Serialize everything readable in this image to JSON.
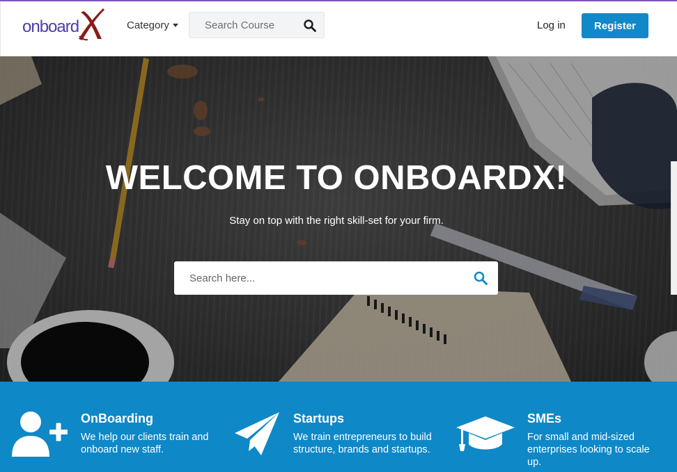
{
  "header": {
    "logo_text": "onboard",
    "category_label": "Category",
    "search_placeholder": "Search Course",
    "login_label": "Log in",
    "register_label": "Register"
  },
  "hero": {
    "title": "WELCOME TO ONBOARDX!",
    "subtitle": "Stay on top with the right skill-set for your firm.",
    "search_placeholder": "Search here..."
  },
  "features": [
    {
      "icon": "add-user-icon",
      "title": "OnBoarding",
      "description": "We help our clients train and onboard new staff."
    },
    {
      "icon": "paper-plane-icon",
      "title": "Startups",
      "description": "We train entrepreneurs to build structure, brands and startups."
    },
    {
      "icon": "graduation-cap-icon",
      "title": "SMEs",
      "description": "For small and mid-sized enterprises looking to scale up."
    }
  ],
  "colors": {
    "brand_blue": "#1388c8",
    "feature_band": "#0e88c7",
    "logo_purple": "#4a3fa8",
    "logo_x": "#8b1a1a",
    "top_accent": "#7a55b8"
  }
}
